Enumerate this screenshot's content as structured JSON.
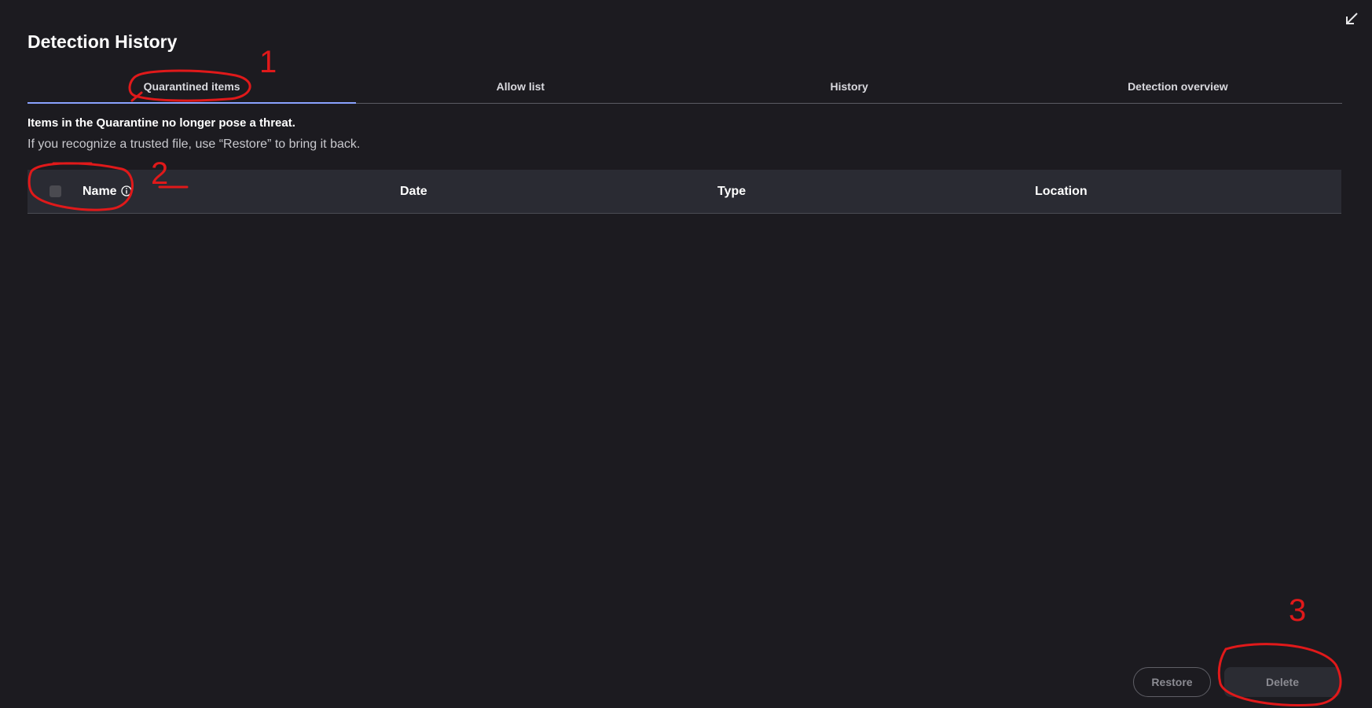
{
  "window": {
    "collapse_icon": "collapse-arrow-icon"
  },
  "page": {
    "title": "Detection History"
  },
  "tabs": [
    {
      "label": "Quarantined items",
      "active": true
    },
    {
      "label": "Allow list",
      "active": false
    },
    {
      "label": "History",
      "active": false
    },
    {
      "label": "Detection overview",
      "active": false
    }
  ],
  "notice": {
    "headline": "Items in the Quarantine no longer pose a threat.",
    "body": "If you recognize a trusted file, use “Restore” to bring it back."
  },
  "table": {
    "columns": [
      "Name",
      "Date",
      "Type",
      "Location"
    ],
    "rows": []
  },
  "actions": {
    "restore_label": "Restore",
    "delete_label": "Delete"
  },
  "annotations": {
    "marker_1": "1",
    "marker_2": "2",
    "marker_3": "3",
    "color": "#e0191a"
  },
  "colors": {
    "background": "#1c1b20",
    "accent": "#8aa2ff",
    "header_bg": "#2a2b33"
  }
}
